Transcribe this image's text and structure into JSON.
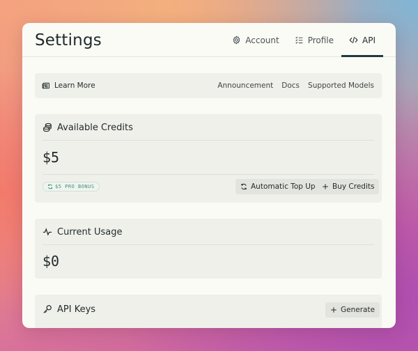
{
  "header": {
    "title": "Settings",
    "tabs": [
      {
        "label": "Account",
        "icon": "gear-icon"
      },
      {
        "label": "Profile",
        "icon": "list-check-icon"
      },
      {
        "label": "API",
        "icon": "code-icon",
        "active": true
      }
    ]
  },
  "learn": {
    "link_label": "Learn More",
    "nav": [
      "Announcement",
      "Docs",
      "Supported Models"
    ]
  },
  "credits": {
    "title": "Available Credits",
    "amount": "$5",
    "badge": "$5 PRO BONUS",
    "auto_topup_label": "Automatic Top Up",
    "buy_label": "Buy Credits"
  },
  "usage": {
    "title": "Current Usage",
    "amount": "$0"
  },
  "keys": {
    "title": "API Keys",
    "generate_label": "Generate"
  },
  "colors": {
    "accent": "#1f3a3d",
    "panel_bg": "#fbfbf6",
    "card_bg": "#f0f0ea",
    "badge_text": "#4a8a7a"
  }
}
